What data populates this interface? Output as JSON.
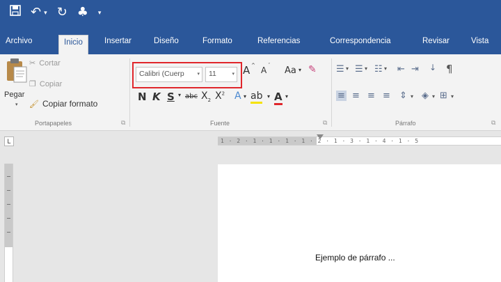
{
  "quick_access": {
    "icons": [
      "save-icon",
      "undo-icon",
      "redo-icon",
      "touch-mode-icon",
      "customize-dropdown-icon"
    ]
  },
  "tabs": [
    "Archivo",
    "Inicio",
    "Insertar",
    "Diseño",
    "Formato",
    "Referencias",
    "Correspondencia",
    "Revisar",
    "Vista"
  ],
  "active_tab": "Inicio",
  "clipboard": {
    "paste_label": "Pegar",
    "cut_label": "Cortar",
    "copy_label": "Copiar",
    "format_painter_label": "Copiar formato",
    "group_label": "Portapapeles"
  },
  "font": {
    "name_value": "Calibri (Cuerp",
    "size_value": "11",
    "grow_label": "A",
    "shrink_label": "A",
    "case_label": "Aa",
    "bold_label": "N",
    "italic_label": "K",
    "underline_label": "S",
    "strike_label": "abc",
    "subscript_label": "X",
    "superscript_label": "X",
    "group_label": "Fuente"
  },
  "paragraph": {
    "group_label": "Párrafo"
  },
  "ruler": {
    "tab_selector": "L",
    "numbers": "1 · 2 · 1 · 1 · 1 · 1 · 2 · 1 · 3 · 1 · 4 · 1 · 5"
  },
  "document": {
    "text": "Ejemplo de párrafo ..."
  },
  "colors": {
    "word_blue": "#2b579a",
    "highlight_red": "#e0262b"
  }
}
